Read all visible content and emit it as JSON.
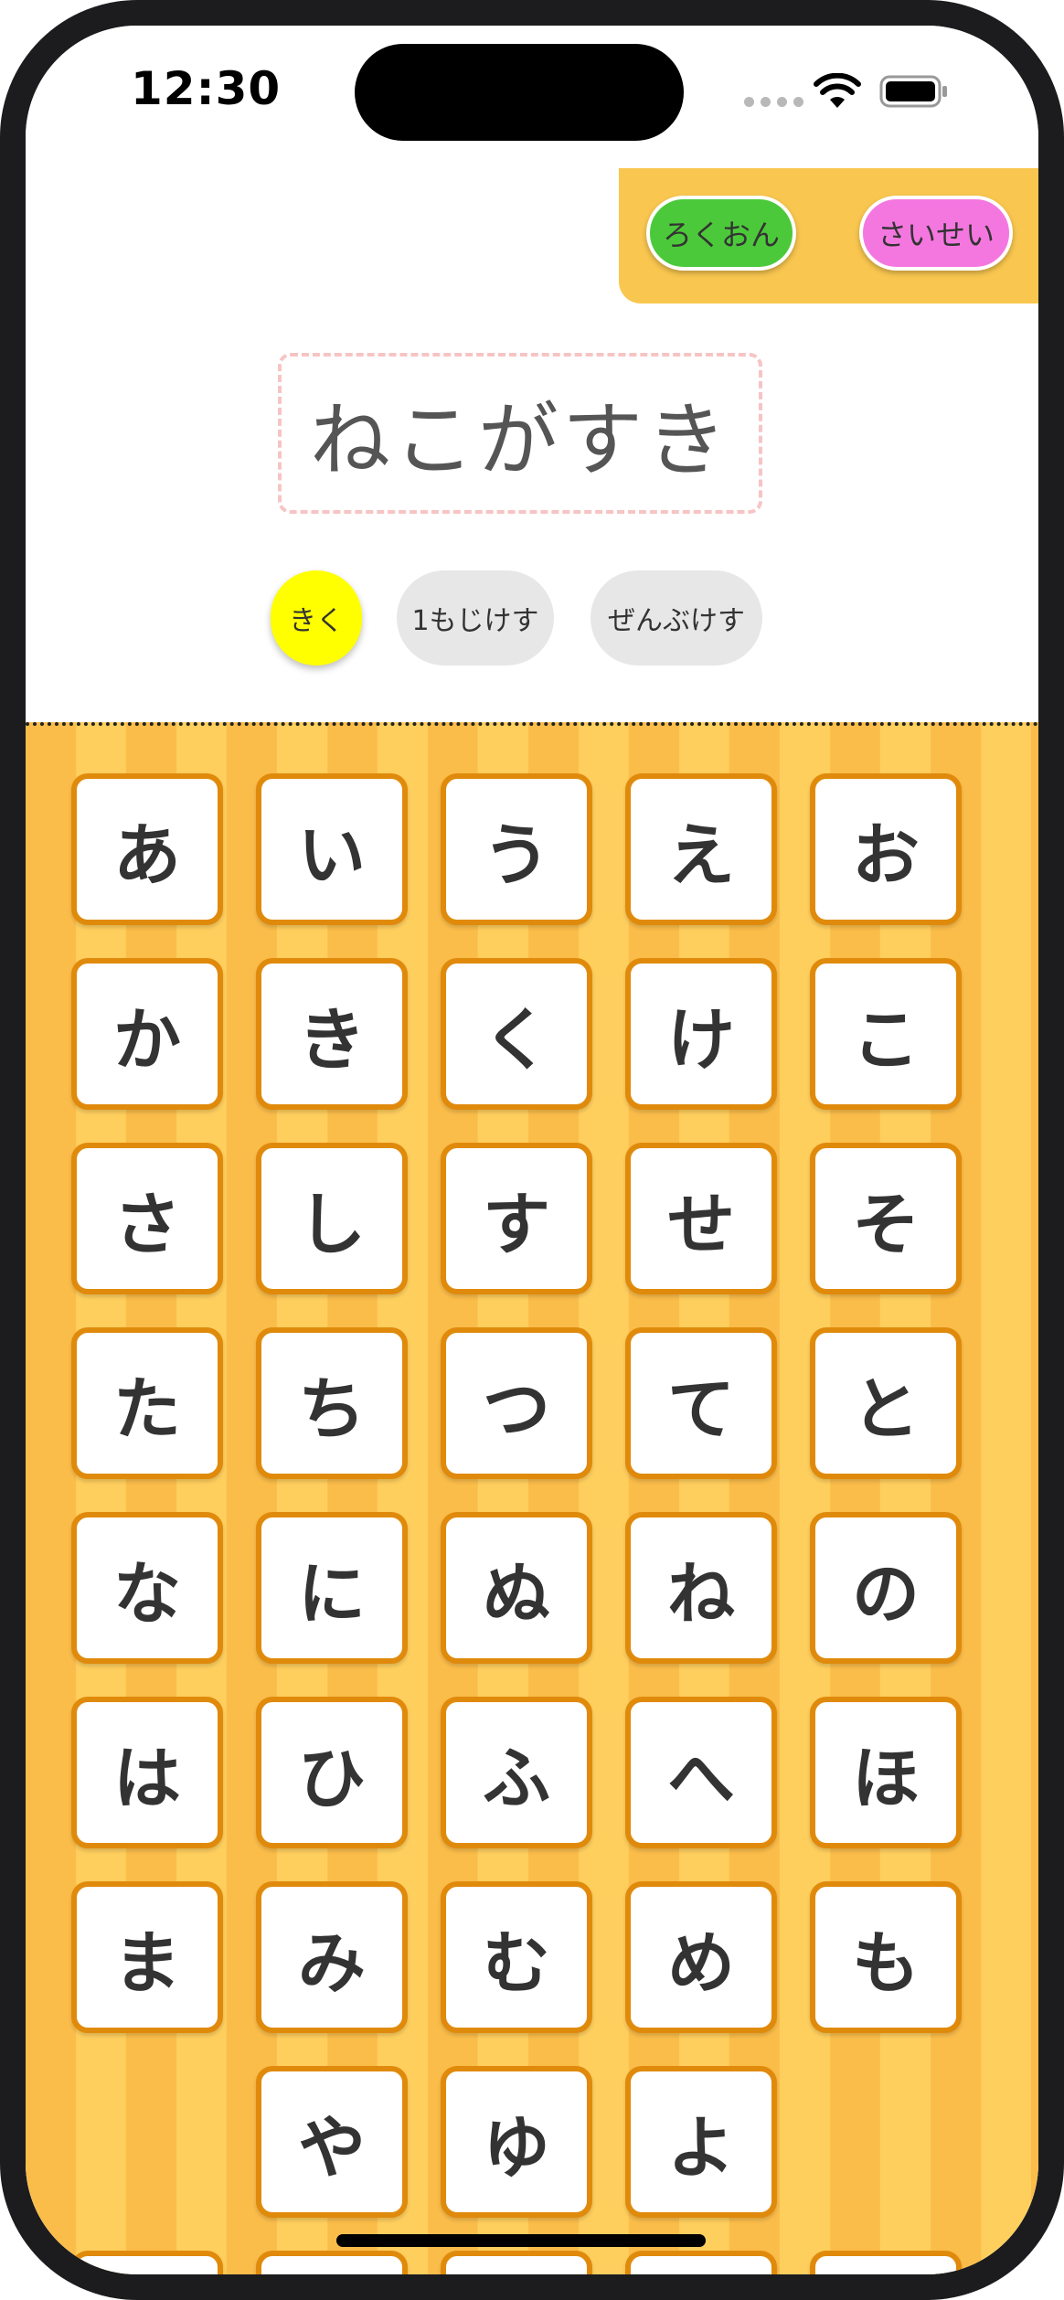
{
  "status_bar": {
    "time": "12:30"
  },
  "top_bar": {
    "record_label": "ろくおん",
    "play_label": "さいせい"
  },
  "word_display": {
    "text": "ねこがすき"
  },
  "actions": {
    "listen_label": "きく",
    "delete_one_label": "1もじけす",
    "delete_all_label": "ぜんぶけす"
  },
  "keyboard": {
    "rows": [
      [
        "あ",
        "い",
        "う",
        "え",
        "お"
      ],
      [
        "か",
        "き",
        "く",
        "け",
        "こ"
      ],
      [
        "さ",
        "し",
        "す",
        "せ",
        "そ"
      ],
      [
        "た",
        "ち",
        "つ",
        "て",
        "と"
      ],
      [
        "な",
        "に",
        "ぬ",
        "ね",
        "の"
      ],
      [
        "は",
        "ひ",
        "ふ",
        "へ",
        "ほ"
      ],
      [
        "ま",
        "み",
        "む",
        "め",
        "も"
      ],
      [
        "",
        "や",
        "ゆ",
        "よ",
        ""
      ]
    ]
  },
  "colors": {
    "record": "#4cc93a",
    "play": "#f477e0",
    "listen": "#ffff00",
    "key_border": "#e08a0c",
    "keyboard_bg": "#fbbd4a",
    "topbar_bg": "#f9c74f"
  }
}
